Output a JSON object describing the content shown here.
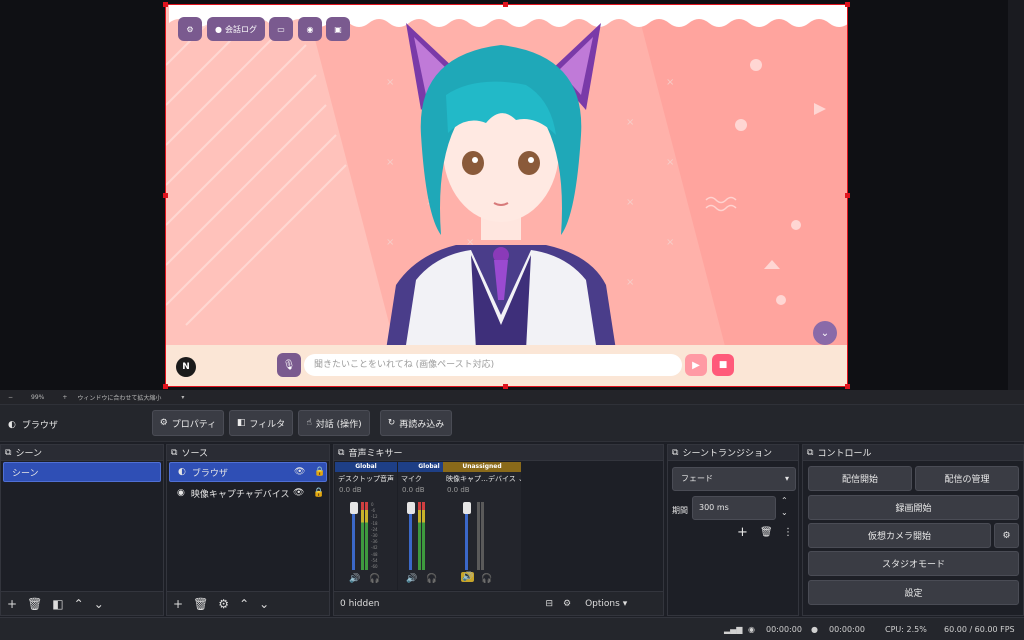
{
  "preview": {
    "toolbar": {
      "history_label": "会話ログ"
    },
    "chat_placeholder": "聞きたいことをいれてね (画像ペースト対応)",
    "logo_letter": "N"
  },
  "zoombar": {
    "minus": "−",
    "zoom": "99%",
    "plus": "+",
    "fit_label": "ウィンドウに合わせて拡大縮小"
  },
  "source_bar": {
    "name": "ブラウザ",
    "properties": "プロパティ",
    "filters": "フィルタ",
    "interact": "対話 (操作)",
    "refresh": "再読み込み"
  },
  "scenes": {
    "title": "シーン",
    "items": [
      "シーン"
    ]
  },
  "sources": {
    "title": "ソース",
    "items": [
      {
        "label": "ブラウザ",
        "selected": true
      },
      {
        "label": "映像キャプチャデバイス",
        "selected": false
      }
    ]
  },
  "mixer": {
    "title": "音声ミキサー",
    "channels": [
      {
        "badge": "Global",
        "badge_color": "#1e3f86",
        "name": "デスクトップ音声",
        "db": "0.0 dB"
      },
      {
        "badge": "Global",
        "badge_color": "#1e3f86",
        "name": "マイク",
        "db": "0.0 dB"
      },
      {
        "badge": "Unassigned",
        "badge_color": "#8a6a1a",
        "name": "映像キャプ…デバイス",
        "db": "0.0 dB"
      }
    ],
    "scale": [
      "0",
      "-6",
      "-12",
      "-18",
      "-24",
      "-30",
      "-36",
      "-42",
      "-48",
      "-54",
      "-60"
    ],
    "hidden": "0 hidden",
    "options": "Options"
  },
  "transitions": {
    "title": "シーントランジション",
    "selected": "フェード",
    "duration_label": "期間",
    "duration_value": "300 ms"
  },
  "controls": {
    "title": "コントロール",
    "start_stream": "配信開始",
    "manage_stream": "配信の管理",
    "start_record": "録画開始",
    "virtual_cam": "仮想カメラ開始",
    "studio_mode": "スタジオモード",
    "settings": "設定"
  },
  "status": {
    "stream_time": "00:00:00",
    "record_time": "00:00:00",
    "cpu": "CPU: 2.5%",
    "fps": "60.00 / 60.00 FPS"
  },
  "colors": {
    "accent": "#2f4fb5",
    "selection_border": "#e0141e",
    "toolbar_purple": "#7a5a8f",
    "send_pink": "#ff9aa4",
    "stop_pink": "#ff5a7a"
  }
}
